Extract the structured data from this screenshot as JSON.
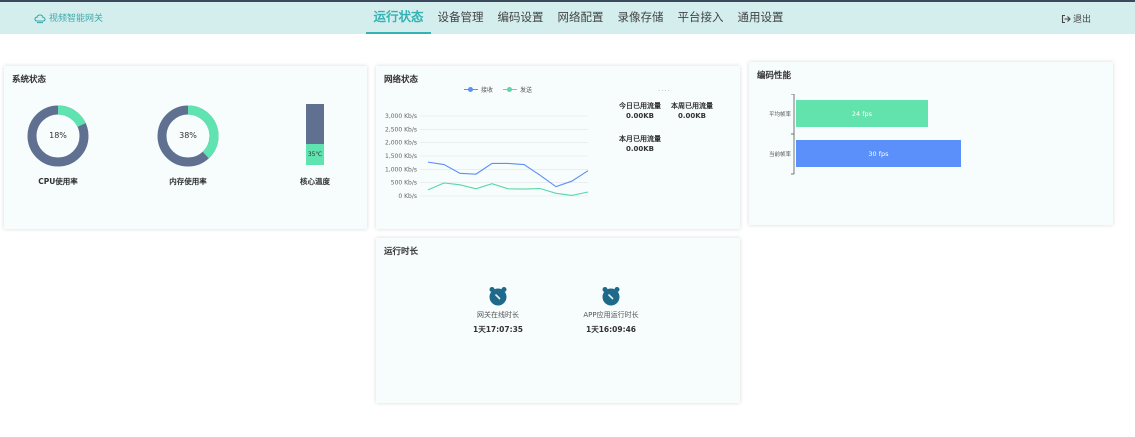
{
  "app": {
    "logo_text": "视频智能网关",
    "logout_label": "退出"
  },
  "nav": [
    {
      "label": "运行状态",
      "active": true
    },
    {
      "label": "设备管理",
      "active": false
    },
    {
      "label": "编码设置",
      "active": false
    },
    {
      "label": "网络配置",
      "active": false
    },
    {
      "label": "录像存储",
      "active": false
    },
    {
      "label": "平台接入",
      "active": false
    },
    {
      "label": "通用设置",
      "active": false
    }
  ],
  "system": {
    "title": "系统状态",
    "cpu": {
      "label": "CPU使用率",
      "value_text": "18%",
      "value": 18
    },
    "mem": {
      "label": "内存使用率",
      "value_text": "38%",
      "value": 38
    },
    "temp": {
      "label": "核心温度",
      "value_text": "35℃",
      "value": 35,
      "max": 100
    }
  },
  "network": {
    "title": "网络状态",
    "dots": "....",
    "stats": {
      "today_label": "今日已用流量",
      "today_value": "0.00KB",
      "week_label": "本周已用流量",
      "week_value": "0.00KB",
      "month_label": "本月已用流量",
      "month_value": "0.00KB"
    },
    "chart_data": {
      "type": "line",
      "x": [
        1,
        2,
        3,
        4,
        5,
        6,
        7,
        8,
        9,
        10,
        11,
        12,
        13
      ],
      "yticks": [
        "3,000 Kb/s",
        "2,500 Kb/s",
        "2,000 Kb/s",
        "1,500 Kb/s",
        "1,000 Kb/s",
        "500 Kb/s",
        "0 Kb/s"
      ],
      "ylim": [
        0,
        3000
      ],
      "series": [
        {
          "name": "接收",
          "color": "#5b8ff9",
          "values": [
            1270,
            1180,
            850,
            820,
            1220,
            1220,
            1180,
            780,
            350,
            560,
            950
          ]
        },
        {
          "name": "发送",
          "color": "#5ad8a6",
          "values": [
            230,
            490,
            420,
            270,
            460,
            270,
            260,
            280,
            100,
            20,
            150
          ]
        }
      ],
      "legend": "top",
      "grid": true
    }
  },
  "encode": {
    "title": "编码性能",
    "chart_data": {
      "type": "bar",
      "orientation": "horizontal",
      "categories": [
        "平均帧率",
        "当前帧率"
      ],
      "values": [
        24,
        30
      ],
      "value_labels": [
        "24 fps",
        "30 fps"
      ],
      "colors": [
        "#62e3ad",
        "#5b8ff9"
      ],
      "xlim": [
        0,
        48
      ]
    }
  },
  "runtime": {
    "title": "运行时长",
    "gateway_label": "网关在线时长",
    "gateway_value": "1天17:07:35",
    "app_label": "APP应用运行时长",
    "app_value": "1天16:09:46"
  }
}
